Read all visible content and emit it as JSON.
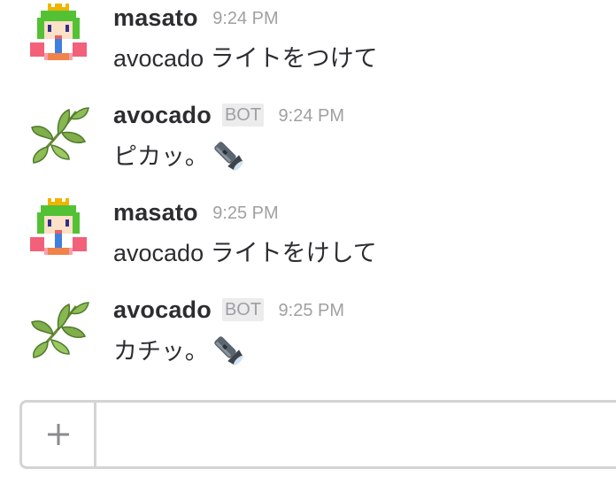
{
  "messages": [
    {
      "author": "masato",
      "is_bot": false,
      "time": "9:24 PM",
      "text": "avocado ライトをつけて",
      "avatar_icon": "pixel-character-avatar-icon",
      "trailing_icon": null
    },
    {
      "author": "avocado",
      "is_bot": true,
      "badge": "BOT",
      "time": "9:24 PM",
      "text": "ピカッ。",
      "avatar_icon": "leaf-branch-avatar-icon",
      "trailing_icon": "flashlight-icon"
    },
    {
      "author": "masato",
      "is_bot": false,
      "time": "9:25 PM",
      "text": "avocado ライトをけして",
      "avatar_icon": "pixel-character-avatar-icon",
      "trailing_icon": null
    },
    {
      "author": "avocado",
      "is_bot": true,
      "badge": "BOT",
      "time": "9:25 PM",
      "text": "カチッ。",
      "avatar_icon": "leaf-branch-avatar-icon",
      "trailing_icon": "flashlight-icon"
    }
  ],
  "composer": {
    "attach_icon": "plus-icon",
    "input_value": "",
    "placeholder": ""
  },
  "colors": {
    "text": "#2c2d30",
    "timestamp": "#a0a0a2",
    "badge_bg": "#ececec",
    "badge_text": "#9e9ea6",
    "composer_border": "#d4d4d6"
  }
}
